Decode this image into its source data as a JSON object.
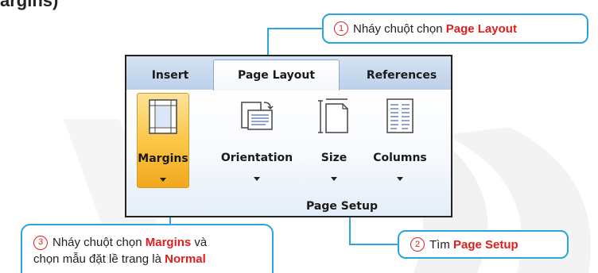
{
  "top_text": "argins)",
  "ribbon": {
    "tabs": [
      {
        "label": "Insert"
      },
      {
        "label": "Page Layout"
      },
      {
        "label": "References"
      }
    ],
    "buttons": [
      {
        "label": "Margins",
        "icon": "margins-icon"
      },
      {
        "label": "Orientation",
        "icon": "orientation-icon"
      },
      {
        "label": "Size",
        "icon": "size-icon"
      },
      {
        "label": "Columns",
        "icon": "columns-icon"
      }
    ],
    "group_label": "Page Setup"
  },
  "callouts": {
    "c1": {
      "num": "1",
      "text": "Nháy chuột chọn ",
      "highlight": "Page Layout"
    },
    "c2": {
      "num": "2",
      "text": "Tìm ",
      "highlight": "Page Setup"
    },
    "c3": {
      "num": "3",
      "line1_text": "Nháy chuột chọn ",
      "line1_highlight": "Margins",
      "line1_suffix": " và",
      "line2_text": "chọn mẫu đặt lề trang là ",
      "line2_highlight": "Normal"
    }
  },
  "colors": {
    "accent_blue": "#2aa5dc",
    "highlight_red": "#e01e1e",
    "selected_orange": "#fac748"
  }
}
